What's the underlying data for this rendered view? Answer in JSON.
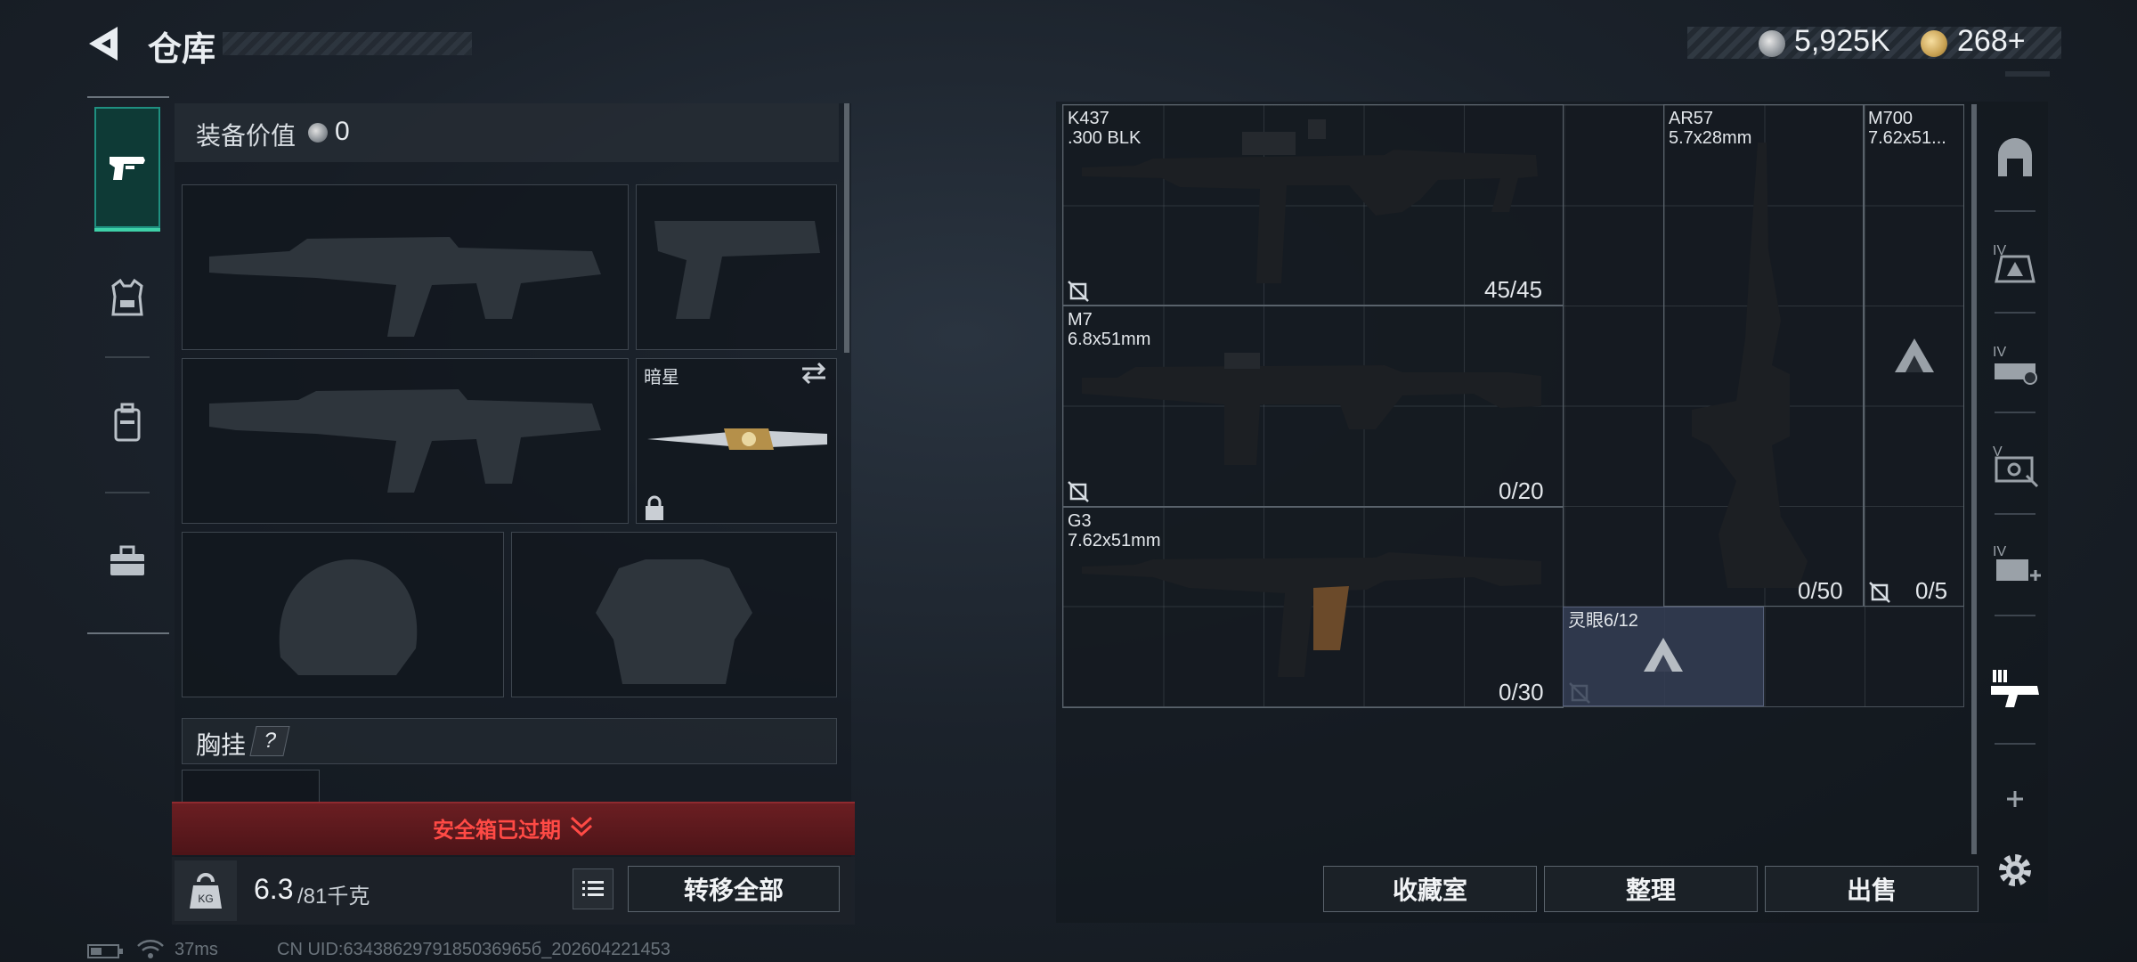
{
  "header": {
    "title": "仓库"
  },
  "currency": [
    {
      "icon": "silver-coin-icon",
      "value": "5,925K"
    },
    {
      "icon": "gold-coin-icon",
      "value": "268+"
    }
  ],
  "tabs": [
    {
      "name": "weapons",
      "icon": "pistol-icon",
      "active": true
    },
    {
      "name": "armor",
      "icon": "armor-vest-icon",
      "active": false
    },
    {
      "name": "backpack",
      "icon": "backpack-icon",
      "active": false
    },
    {
      "name": "toolbox",
      "icon": "toolbox-icon",
      "active": false
    }
  ],
  "equipment": {
    "value_label": "装备价值",
    "value": "0",
    "knife_label": "暗星",
    "chest_label": "胸挂",
    "help": "?"
  },
  "safebox": {
    "expired_text": "安全箱已过期"
  },
  "weight": {
    "unit_icon": "KG",
    "current": "6.3",
    "max": "/81千克"
  },
  "actions": {
    "transfer_all": "转移全部"
  },
  "stash": {
    "items": [
      {
        "name": "K437",
        "ammo": ".300 BLK",
        "count": "45/45"
      },
      {
        "name": "M7",
        "ammo": "6.8x51mm",
        "count": "0/20"
      },
      {
        "name": "G3",
        "ammo": "7.62x51mm",
        "count": "0/30"
      },
      {
        "name": "AR57",
        "ammo": "5.7x28mm",
        "count": "0/50"
      },
      {
        "name": "M700",
        "ammo": "7.62x51...",
        "count": "0/5"
      }
    ],
    "lingyan": "灵眼6/12"
  },
  "bottom_buttons": {
    "collection": "收藏室",
    "sort": "整理",
    "sell": "出售"
  },
  "status": {
    "ping": "37ms",
    "uid": "CN UID:6343862979185036965б_202604221453"
  },
  "colors": {
    "accent": "#3ed0a8",
    "danger": "#ff4a45",
    "panel": "#1b2127"
  }
}
